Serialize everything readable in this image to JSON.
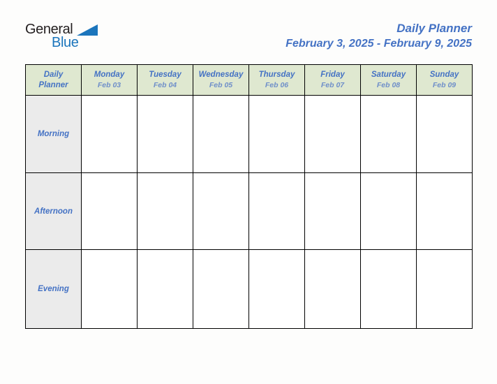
{
  "brand": {
    "word_dark": "General",
    "word_blue": "Blue",
    "triangle_color": "#1b75bc",
    "dark_color": "#231f20"
  },
  "header": {
    "title": "Daily Planner",
    "date_range": "February 3, 2025 - February 9, 2025",
    "title_color": "#4472c4"
  },
  "table": {
    "corner": {
      "line1": "Daily",
      "line2": "Planner"
    },
    "header_bg": "#dfe8d0",
    "label_bg": "#ebebeb",
    "columns": [
      {
        "day": "Monday",
        "date": "Feb 03"
      },
      {
        "day": "Tuesday",
        "date": "Feb 04"
      },
      {
        "day": "Wednesday",
        "date": "Feb 05"
      },
      {
        "day": "Thursday",
        "date": "Feb 06"
      },
      {
        "day": "Friday",
        "date": "Feb 07"
      },
      {
        "day": "Saturday",
        "date": "Feb 08"
      },
      {
        "day": "Sunday",
        "date": "Feb 09"
      }
    ],
    "rows": [
      {
        "label": "Morning",
        "cells": [
          "",
          "",
          "",
          "",
          "",
          "",
          ""
        ]
      },
      {
        "label": "Afternoon",
        "cells": [
          "",
          "",
          "",
          "",
          "",
          "",
          ""
        ]
      },
      {
        "label": "Evening",
        "cells": [
          "",
          "",
          "",
          "",
          "",
          "",
          ""
        ]
      }
    ]
  }
}
